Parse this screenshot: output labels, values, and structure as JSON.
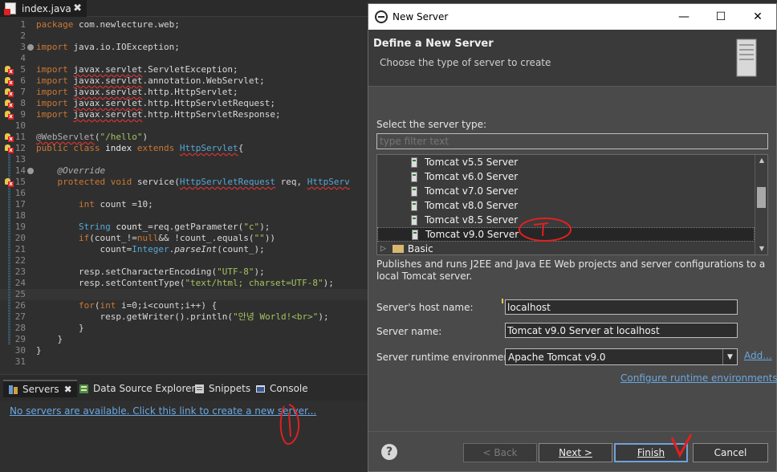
{
  "editor": {
    "tab_title": "index.java",
    "tab_close": "✖",
    "lines": [
      {
        "n": "1"
      },
      {
        "n": "2"
      },
      {
        "n": "3"
      },
      {
        "n": "4"
      },
      {
        "n": "5"
      },
      {
        "n": "6"
      },
      {
        "n": "7"
      },
      {
        "n": "8"
      },
      {
        "n": "9"
      },
      {
        "n": "10"
      },
      {
        "n": "11"
      },
      {
        "n": "12"
      },
      {
        "n": "13"
      },
      {
        "n": "14"
      },
      {
        "n": "15"
      },
      {
        "n": "16"
      },
      {
        "n": "17"
      },
      {
        "n": "18"
      },
      {
        "n": "19"
      },
      {
        "n": "20"
      },
      {
        "n": "21"
      },
      {
        "n": "22"
      },
      {
        "n": "23"
      },
      {
        "n": "24"
      },
      {
        "n": "25"
      },
      {
        "n": "26"
      },
      {
        "n": "27"
      },
      {
        "n": "28"
      },
      {
        "n": "29"
      },
      {
        "n": "30"
      },
      {
        "n": "31"
      }
    ],
    "code": {
      "l1_kw": "package",
      "l1_rest": " com.newlecture.web;",
      "l3_kw": "import",
      "l3_rest": " java.io.IOException;",
      "l5_kw": "import",
      "l5_pkg": "javax.servlet",
      "l5_rest": ".ServletException;",
      "l6_kw": "import",
      "l6_pkg": "javax.servlet",
      "l6_rest": ".annotation.WebServlet;",
      "l7_kw": "import",
      "l7_pkg": "javax.servlet",
      "l7_rest": ".http.HttpServlet;",
      "l8_kw": "import",
      "l8_pkg": "javax.servlet",
      "l8_rest": ".http.HttpServletRequest;",
      "l9_kw": "import",
      "l9_pkg": "javax.servlet",
      "l9_rest": ".http.HttpServletResponse;",
      "l11_ann": "@WebServlet",
      "l11_p1": "(",
      "l11_str": "\"/hello\"",
      "l11_p2": ")",
      "l12_kw": "public class",
      "l12_name": " index ",
      "l12_kw2": "extends",
      "l12_sp": " ",
      "l12_type": "HttpServlet",
      "l12_br": "{",
      "l14_ann": "@Override",
      "l15_kw": "protected void",
      "l15_m": " service(",
      "l15_t1": "HttpServletRequest",
      "l15_v1": " req, ",
      "l15_t2": "HttpServ",
      "l17_kw": "int",
      "l17_rest": " count =10;",
      "l19_t": "String",
      "l19_v": " count_",
      "l19_rest": "=req.getParameter(",
      "l19_str": "\"c\"",
      "l19_end": ");",
      "l20_kw": "if",
      "l20_a": "(count_!=",
      "l20_null": "null",
      "l20_b": "&& !count_.equals(",
      "l20_str": "\"\"",
      "l20_end": "))",
      "l21_a": "count=",
      "l21_t": "Integer",
      "l21_dot": ".",
      "l21_m": "parseInt",
      "l21_end": "(count_);",
      "l23_a": "resp.setCharacterEncoding(",
      "l23_str": "\"UTF-8\"",
      "l23_end": ");",
      "l24_a": "resp.setContentType(",
      "l24_str": "\"text/html; charset=UTF-8\"",
      "l24_end": ");",
      "l26_kw": "for",
      "l26_a": "(",
      "l26_kw2": "int",
      "l26_b": " i=0;i<count;i++) {",
      "l27_a": "resp.getWriter().println(",
      "l27_str": "\"안녕 World!<br>\"",
      "l27_end": ");",
      "l28": "}",
      "l29": "}",
      "l30": "}"
    }
  },
  "bottom_panel": {
    "tabs": [
      {
        "label": "Servers",
        "close": "✖"
      },
      {
        "label": "Data Source Explorer"
      },
      {
        "label": "Snippets"
      },
      {
        "label": "Console"
      }
    ],
    "link": "No servers are available. Click this link to create a new server..."
  },
  "dialog": {
    "title": "New Server",
    "header_title": "Define a New Server",
    "header_subtitle": "Choose the type of server to create",
    "select_label": "Select the server type:",
    "filter_placeholder": "type filter text",
    "server_types": [
      "Tomcat v5.5 Server",
      "Tomcat v6.0 Server",
      "Tomcat v7.0 Server",
      "Tomcat v8.0 Server",
      "Tomcat v8.5 Server",
      "Tomcat v9.0 Server"
    ],
    "selected_type": "Tomcat v9.0 Server",
    "folder_item": "Basic",
    "description": "Publishes and runs J2EE and Java EE Web projects and server configurations to a local Tomcat server.",
    "host_label": "Server's host name:",
    "host_value": "localhost",
    "name_label": "Server name:",
    "name_value": "Tomcat v9.0 Server at localhost",
    "runtime_label": "Server runtime environment:",
    "runtime_value": "Apache Tomcat v9.0",
    "add_link": "Add...",
    "configure_link": "Configure runtime environments...",
    "buttons": {
      "help": "?",
      "back": "< Back",
      "next": "Next >",
      "finish": "Finish",
      "cancel": "Cancel"
    }
  },
  "colors": {
    "link": "#6aa7e0",
    "annotation": "#e02020",
    "default_button_border": "#6fa3d8"
  }
}
